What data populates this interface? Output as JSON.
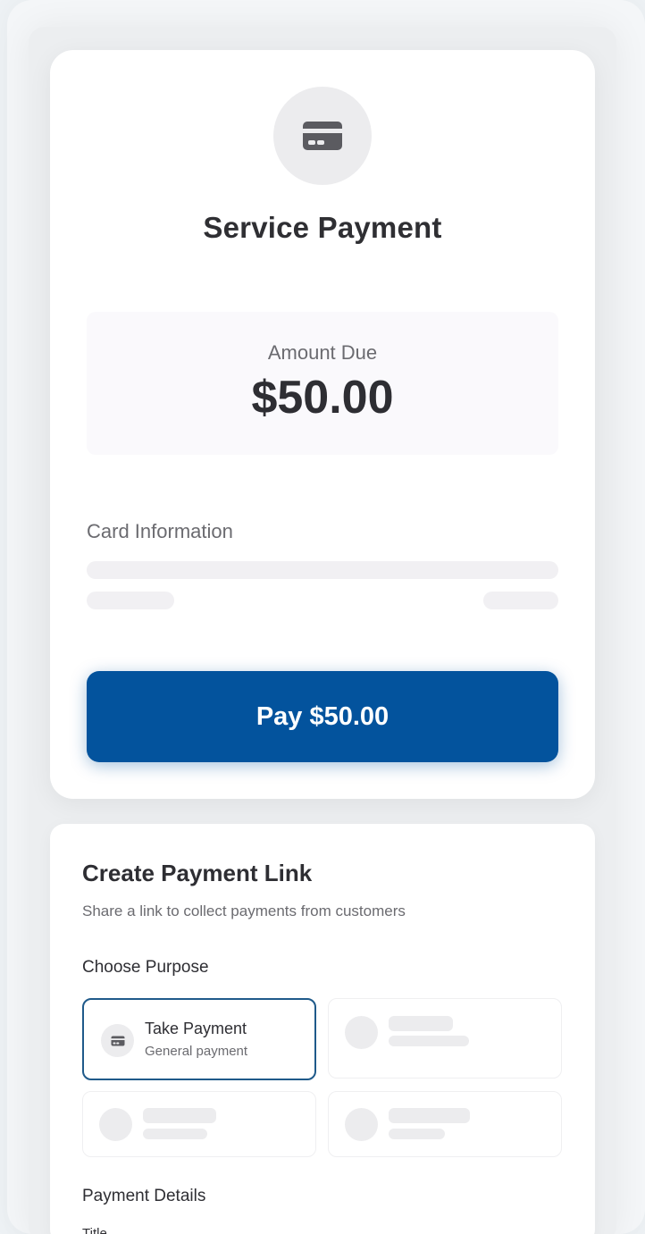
{
  "payment": {
    "icon": "credit-card-icon",
    "title": "Service Payment",
    "amount_label": "Amount Due",
    "amount_value": "$50.00",
    "card_info_label": "Card Information",
    "pay_button_label": "Pay $50.00"
  },
  "link": {
    "title": "Create Payment Link",
    "subtitle": "Share a link to collect payments from customers",
    "purpose_label": "Choose Purpose",
    "options": [
      {
        "title": "Take Payment",
        "subtitle": "General payment",
        "icon": "credit-card-icon",
        "selected": true
      }
    ],
    "details_label": "Payment Details",
    "title_field_label": "Title"
  },
  "colors": {
    "primary": "#03539d",
    "selected_border": "#1f5a8a",
    "background": "#eef2f5"
  }
}
